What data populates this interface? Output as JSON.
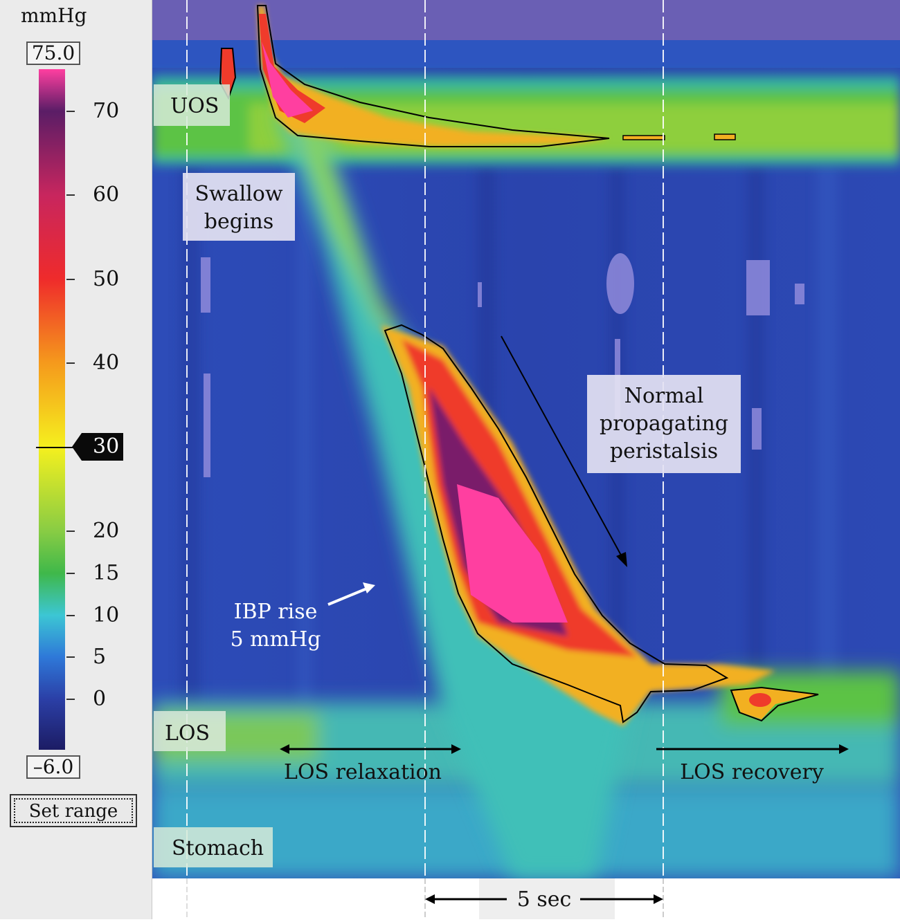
{
  "scale": {
    "unit": "mmHg",
    "max_label": "75.0",
    "min_label": "–6.0",
    "min_value": -6.0,
    "max_value": 75.0,
    "ticks": [
      {
        "value": 70,
        "label": "70"
      },
      {
        "value": 60,
        "label": "60"
      },
      {
        "value": 50,
        "label": "50"
      },
      {
        "value": 40,
        "label": "40"
      },
      {
        "value": 20,
        "label": "20"
      },
      {
        "value": 15,
        "label": "15"
      },
      {
        "value": 10,
        "label": "10"
      },
      {
        "value": 5,
        "label": "5"
      },
      {
        "value": 0,
        "label": "0"
      }
    ],
    "isobar_marker": {
      "value": 30,
      "label": "30"
    },
    "set_range_button": "Set range"
  },
  "chart_data": {
    "type": "heatmap",
    "title": "",
    "colorscale": [
      {
        "value": -6,
        "color": "#1c1c64"
      },
      {
        "value": 0,
        "color": "#2b3fa6"
      },
      {
        "value": 5,
        "color": "#2e78d8"
      },
      {
        "value": 10,
        "color": "#3cc6d4"
      },
      {
        "value": 15,
        "color": "#3fb84a"
      },
      {
        "value": 20,
        "color": "#88cc44"
      },
      {
        "value": 30,
        "color": "#f5f01e"
      },
      {
        "value": 40,
        "color": "#f59a1c"
      },
      {
        "value": 50,
        "color": "#ef2b2b"
      },
      {
        "value": 60,
        "color": "#c8265e"
      },
      {
        "value": 70,
        "color": "#5a1d66"
      },
      {
        "value": 75,
        "color": "#ff3fa0"
      }
    ],
    "isobaric_contour_mmHg": 30,
    "regions": {
      "uos": "UOS",
      "los": "LOS",
      "stomach": "Stomach"
    },
    "annotations": {
      "swallow": "Swallow begins",
      "peristalsis": "Normal propagating peristalsis",
      "ibp_line1": "IBP rise",
      "ibp_line2": "5 mmHg",
      "los_relaxation": "LOS relaxation",
      "los_recovery": "LOS recovery"
    },
    "time_scale": {
      "label": "5 sec",
      "seconds": 5
    }
  },
  "colors": {
    "background_blue": "#2f47b0",
    "uos_band": "#62c24a",
    "los_band": "#4cc3b8",
    "peak_pink": "#ff3fa0",
    "contour": "#000000",
    "label_box": "#e6e6f0"
  }
}
